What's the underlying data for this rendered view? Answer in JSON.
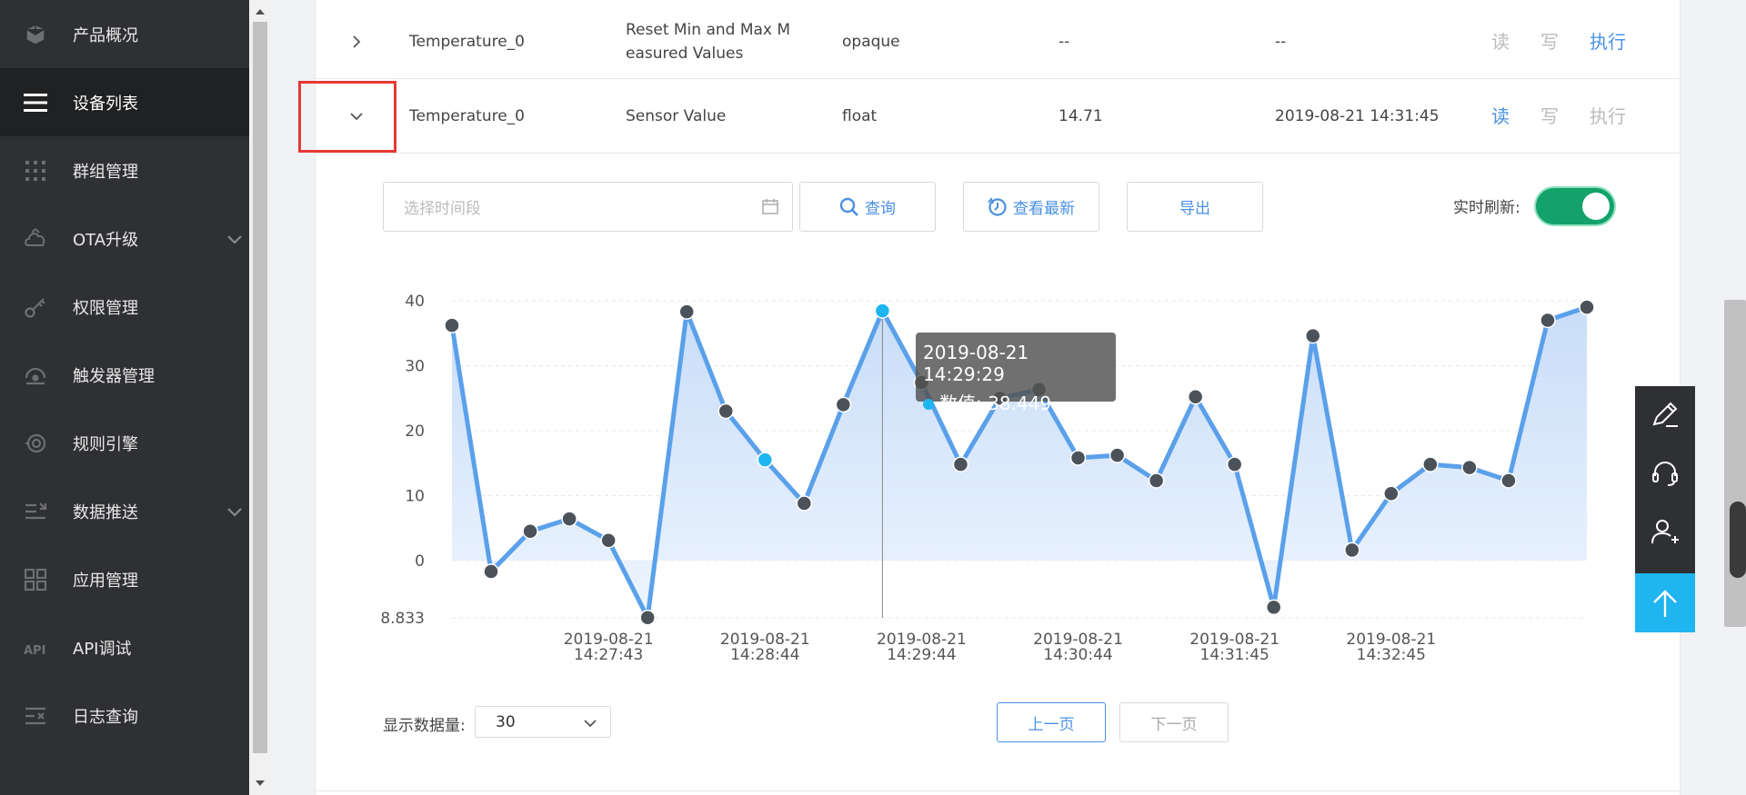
{
  "sidebar": {
    "items": [
      {
        "label": "产品概况",
        "icon": "cube-icon"
      },
      {
        "label": "设备列表",
        "icon": "list-icon",
        "active": true
      },
      {
        "label": "群组管理",
        "icon": "grid-dots-icon"
      },
      {
        "label": "OTA升级",
        "icon": "cloud-upload-icon",
        "expandable": true
      },
      {
        "label": "权限管理",
        "icon": "key-icon"
      },
      {
        "label": "触发器管理",
        "icon": "trigger-icon"
      },
      {
        "label": "规则引擎",
        "icon": "rule-engine-icon"
      },
      {
        "label": "数据推送",
        "icon": "push-icon",
        "expandable": true
      },
      {
        "label": "应用管理",
        "icon": "apps-icon"
      },
      {
        "label": "API调试",
        "icon": "api-icon"
      },
      {
        "label": "日志查询",
        "icon": "log-icon"
      }
    ]
  },
  "table": {
    "rows": [
      {
        "name": "Temperature_0",
        "resource": "Reset Min and Max M easured Values",
        "type": "opaque",
        "value": "--",
        "time": "--",
        "read": "读",
        "write": "写",
        "exec": "执行",
        "expanded": false
      },
      {
        "name": "Temperature_0",
        "resource": "Sensor Value",
        "type": "float",
        "value": "14.71",
        "time": "2019-08-21 14:31:45",
        "read": "读",
        "write": "写",
        "exec": "执行",
        "expanded": true
      }
    ]
  },
  "toolbar": {
    "date_placeholder": "选择时间段",
    "query_label": "查询",
    "latest_label": "查看最新",
    "export_label": "导出",
    "realtime_label": "实时刷新:",
    "realtime_on": true
  },
  "tooltip": {
    "time": "2019-08-21 14:29:29",
    "series": "数值",
    "value": "38.449"
  },
  "chart_data": {
    "type": "area",
    "title": "",
    "xlabel": "",
    "ylabel": "",
    "y_ticks": [
      "40",
      "30",
      "20",
      "10",
      "0",
      "8.833"
    ],
    "x_ticks": [
      {
        "date": "2019-08-21",
        "time": "14:27:43"
      },
      {
        "date": "2019-08-21",
        "time": "14:28:44"
      },
      {
        "date": "2019-08-21",
        "time": "14:29:44"
      },
      {
        "date": "2019-08-21",
        "time": "14:30:44"
      },
      {
        "date": "2019-08-21",
        "time": "14:31:45"
      },
      {
        "date": "2019-08-21",
        "time": "14:32:45"
      }
    ],
    "series": [
      {
        "name": "数值",
        "color": "#5aa0ea",
        "values": [
          36.2,
          -1.7,
          4.5,
          6.4,
          3.1,
          -8.8,
          38.3,
          23.0,
          15.5,
          8.8,
          24.0,
          38.449,
          27.4,
          14.8,
          25.0,
          26.3,
          15.8,
          16.2,
          12.3,
          25.2,
          14.8,
          -7.2,
          34.6,
          1.6,
          10.3,
          14.8,
          14.3,
          12.3,
          37.0,
          39.0
        ],
        "highlight_index": 11,
        "highlight_color": "#1fb5f0"
      }
    ]
  },
  "footer": {
    "count_label": "显示数据量:",
    "count_value": "30",
    "prev_label": "上一页",
    "next_label": "下一页"
  }
}
